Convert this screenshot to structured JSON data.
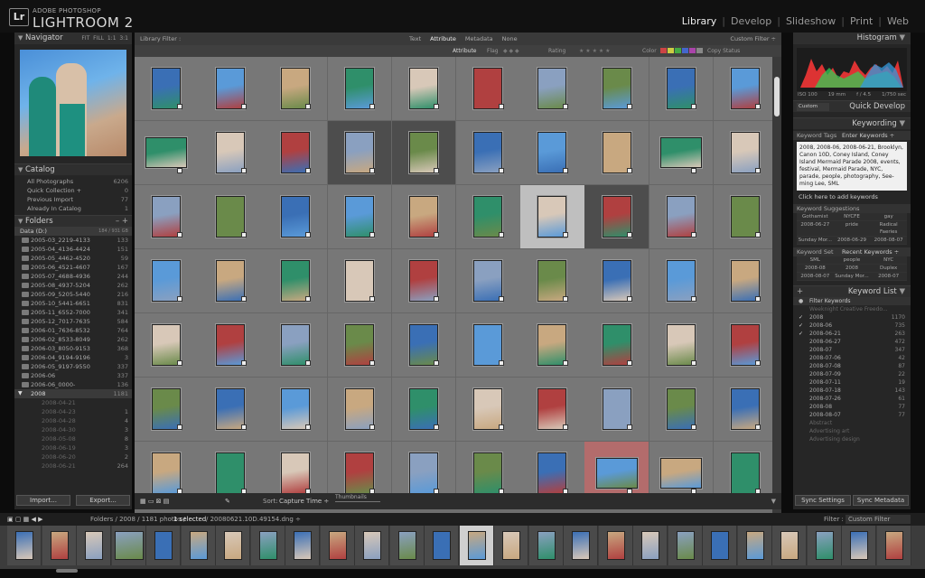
{
  "app": {
    "brand_sup": "ADOBE PHOTOSHOP",
    "brand": "LIGHTROOM 2",
    "logo": "Lr"
  },
  "modules": [
    {
      "label": "Library",
      "active": true
    },
    {
      "label": "Develop"
    },
    {
      "label": "Slideshow"
    },
    {
      "label": "Print"
    },
    {
      "label": "Web"
    }
  ],
  "navigator": {
    "title": "Navigator",
    "zooms": [
      "FIT",
      "FILL",
      "1:1",
      "3:1"
    ]
  },
  "catalog": {
    "title": "Catalog",
    "items": [
      {
        "label": "All Photographs",
        "count": "6206"
      },
      {
        "label": "Quick Collection +",
        "count": "0"
      },
      {
        "label": "Previous Import",
        "count": "77"
      },
      {
        "label": "Already In Catalog",
        "count": "1"
      }
    ]
  },
  "folders": {
    "title": "Folders",
    "volume": "Data (D:)",
    "volume_info": "184 / 931 GB",
    "items": [
      {
        "label": "2005-03_2219-4133",
        "count": "133"
      },
      {
        "label": "2005-04_4136-4424",
        "count": "151"
      },
      {
        "label": "2005-05_4462-4520",
        "count": "59"
      },
      {
        "label": "2005-06_4521-4607",
        "count": "167"
      },
      {
        "label": "2005-07_4688-4936",
        "count": "244"
      },
      {
        "label": "2005-08_4937-5204",
        "count": "262"
      },
      {
        "label": "2005-09_5205-5440",
        "count": "216"
      },
      {
        "label": "2005-10_5441-6651",
        "count": "831"
      },
      {
        "label": "2005-11_6552-7000",
        "count": "341"
      },
      {
        "label": "2005-12_7017-7635",
        "count": "584"
      },
      {
        "label": "2006-01_7636-8532",
        "count": "764"
      },
      {
        "label": "2006-02_8533-8049",
        "count": "262"
      },
      {
        "label": "2006-03_8050-9153",
        "count": "368"
      },
      {
        "label": "2006-04_9194-9196",
        "count": "3"
      },
      {
        "label": "2006-05_9197-9550",
        "count": "337"
      },
      {
        "label": "2006-06",
        "count": "337"
      },
      {
        "label": "2006-06_0000-",
        "count": "136"
      }
    ],
    "open": {
      "label": "2008",
      "count": "1181"
    },
    "subitems": [
      {
        "label": "2008-04-21",
        "count": ""
      },
      {
        "label": "2008-04-23",
        "count": "1"
      },
      {
        "label": "2008-04-28",
        "count": "4"
      },
      {
        "label": "2008-04-30",
        "count": "3"
      },
      {
        "label": "2008-05-08",
        "count": "8"
      },
      {
        "label": "2008-06-19",
        "count": "3"
      },
      {
        "label": "2008-06-20",
        "count": "2"
      },
      {
        "label": "2008-06-21",
        "count": "264"
      }
    ]
  },
  "left_buttons": {
    "import": "Import...",
    "export": "Export..."
  },
  "filter": {
    "title": "Library Filter :",
    "tabs": [
      "Text",
      "Attribute",
      "Metadata",
      "None"
    ],
    "custom": "Custom Filter ÷",
    "attr_label": "Attribute",
    "flag": "Flag",
    "rating": "Rating",
    "color": "Color",
    "copy_status": "Copy Status"
  },
  "toolbar": {
    "sort_label": "Sort:",
    "sort_value": "Capture Time ÷",
    "thumbs": "Thumbnails"
  },
  "filmstrip_header": {
    "path": "Folders / 2008 / 1181 photos /",
    "selected": "1 selected",
    "file": "/ 20080621.10D.49154.dng ÷",
    "filter_label": "Filter :",
    "filter_value": "Custom Filter"
  },
  "histogram": {
    "title": "Histogram",
    "iso": "ISO 100",
    "focal": "19 mm",
    "fstop": "f / 4.5",
    "shutter": "1/750 sec"
  },
  "quick_develop": {
    "title": "Quick Develop",
    "preset": "Custom"
  },
  "keywording": {
    "title": "Keywording",
    "tags_label": "Keyword Tags",
    "tags_mode": "Enter Keywords ÷",
    "keywords": "2008, 2008-06, 2008-06-21, Brooklyn, Canon 10D, Coney Island, Coney Island Mermaid Parade 2008, events, festival, Mermaid Parade, NYC, parade, people, photography, See-ming Lee, SML",
    "add_hint": "Click here to add keywords",
    "suggest_title": "Keyword Suggestions",
    "suggestions": [
      "Gothamist",
      "NYCFE",
      "gay",
      "2008-06-27",
      "pride",
      "Radical Faeries",
      "Sunday Mor...",
      "2008-06-29",
      "2008-08-07"
    ],
    "set_label": "Keyword Set",
    "set_value": "Recent Keywords ÷",
    "set": [
      "SML",
      "people",
      "NYC",
      "2008-08",
      "2008",
      "Duplex",
      "2008-08-07",
      "Sunday Mor...",
      "2008-07"
    ]
  },
  "keyword_list": {
    "title": "Keyword List",
    "filter": "Filter Keywords",
    "items": [
      {
        "label": "Weeknight Creative Freedo...",
        "count": "",
        "dim": true
      },
      {
        "label": "2008",
        "count": "1170",
        "check": true
      },
      {
        "label": "2008-06",
        "count": "735",
        "check": true
      },
      {
        "label": "2008-06-21",
        "count": "263",
        "check": true
      },
      {
        "label": "2008-06-27",
        "count": "472"
      },
      {
        "label": "2008-07",
        "count": "347"
      },
      {
        "label": "2008-07-06",
        "count": "42"
      },
      {
        "label": "2008-07-08",
        "count": "87"
      },
      {
        "label": "2008-07-09",
        "count": "22"
      },
      {
        "label": "2008-07-11",
        "count": "19"
      },
      {
        "label": "2008-07-18",
        "count": "143"
      },
      {
        "label": "2008-07-26",
        "count": "61"
      },
      {
        "label": "2008-08",
        "count": "77"
      },
      {
        "label": "2008-08-07",
        "count": "77"
      },
      {
        "label": "Abstract",
        "count": "",
        "dim": true
      },
      {
        "label": "Advertising art",
        "count": "",
        "dim": true
      },
      {
        "label": "Advertising design",
        "count": "",
        "dim": true
      }
    ]
  },
  "right_buttons": {
    "sync_settings": "Sync Settings",
    "sync_metadata": "Sync Metadata"
  },
  "colors": {
    "panel": "#282828",
    "grid": "#6e6e6e",
    "selected": "#bfbfbf",
    "accent": "#eeeeee"
  }
}
